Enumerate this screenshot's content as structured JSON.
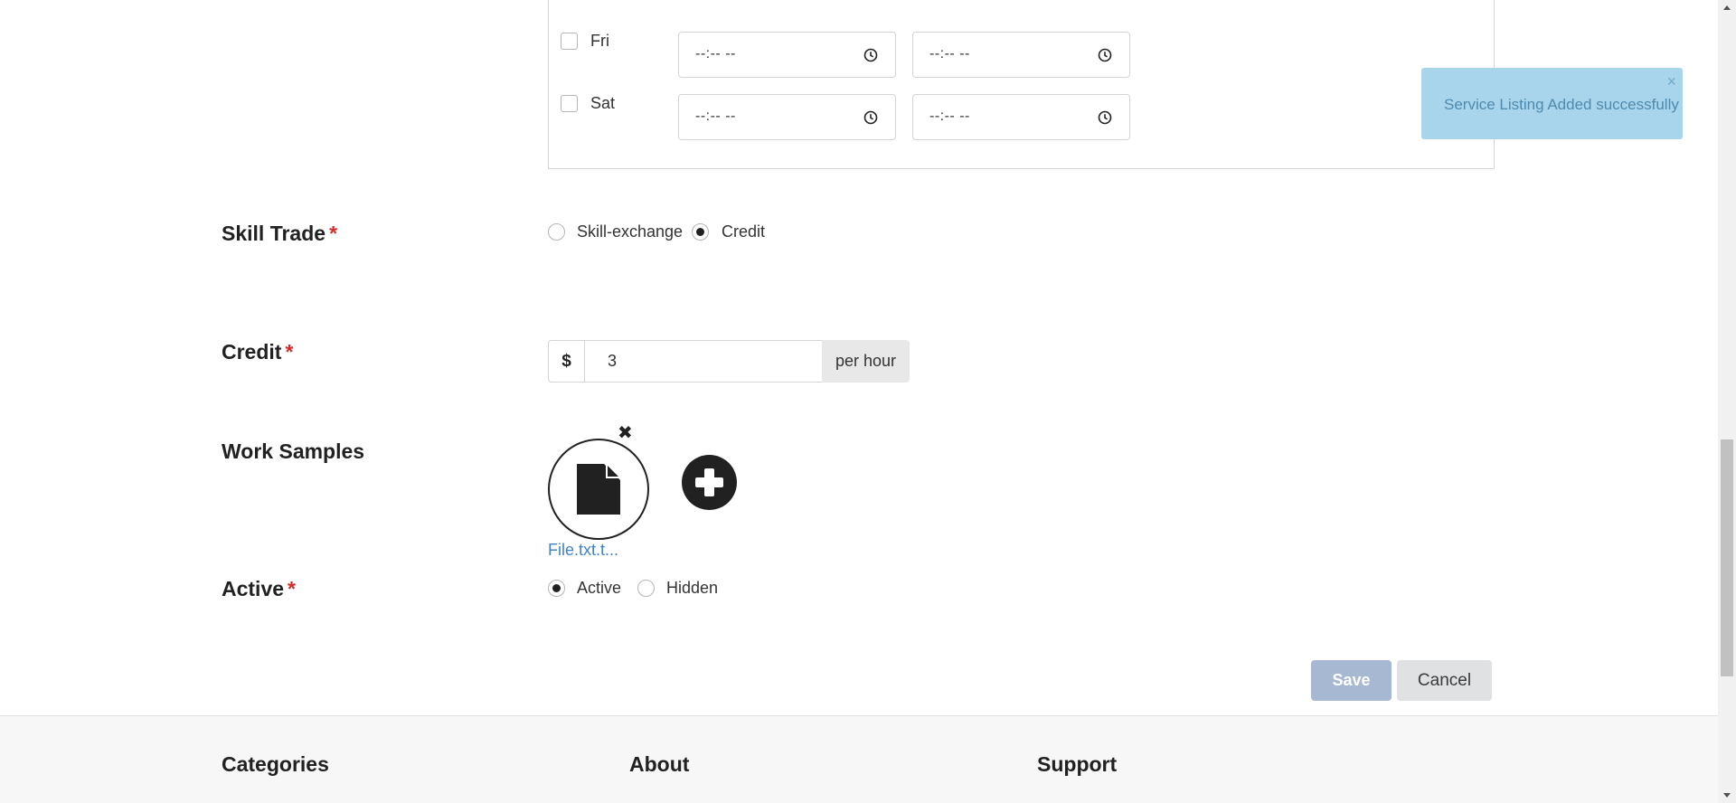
{
  "availability": {
    "days": [
      {
        "name": "Fri",
        "checked": false,
        "start_time": "--:-- --",
        "end_time": "--:-- --"
      },
      {
        "name": "Sat",
        "checked": false,
        "start_time": "--:-- --",
        "end_time": "--:-- --"
      }
    ]
  },
  "toast": {
    "message": "Service Listing Added successfully",
    "close_glyph": "×"
  },
  "skill_trade": {
    "label": "Skill Trade",
    "required_mark": "*",
    "options": [
      {
        "label": "Skill-exchange",
        "selected": false
      },
      {
        "label": "Credit",
        "selected": true
      }
    ]
  },
  "credit": {
    "label": "Credit",
    "required_mark": "*",
    "prefix": "$",
    "value": "3",
    "suffix": "per hour"
  },
  "work_samples": {
    "label": "Work Samples",
    "file_name": "File.txt.t...",
    "remove_glyph": "✖"
  },
  "active": {
    "label": "Active",
    "required_mark": "*",
    "options": [
      {
        "label": "Active",
        "selected": true
      },
      {
        "label": "Hidden",
        "selected": false
      }
    ]
  },
  "actions": {
    "save_label": "Save",
    "cancel_label": "Cancel"
  },
  "footer": {
    "headings": [
      "Categories",
      "About",
      "Support"
    ]
  },
  "colors": {
    "toast_bg": "#a9d5ec",
    "link": "#4183c4",
    "required": "#db2828",
    "save_bg": "#a7b9d2"
  }
}
